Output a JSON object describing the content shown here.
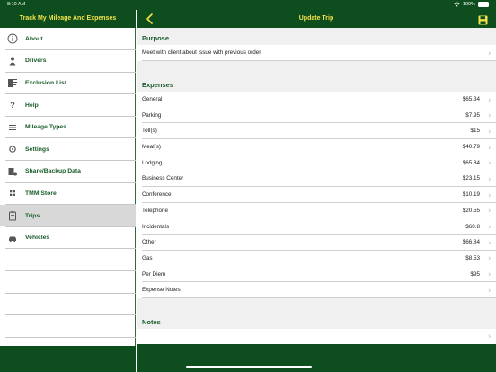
{
  "status": {
    "time": "8:10 AM",
    "battery": "100%"
  },
  "sidebar": {
    "title": "Track My Mileage And Expenses",
    "items": [
      {
        "label": "About",
        "icon": "info-icon"
      },
      {
        "label": "Drivers",
        "icon": "person-icon"
      },
      {
        "label": "Exclusion List",
        "icon": "exclusion-list-icon"
      },
      {
        "label": "Help",
        "icon": "question-icon"
      },
      {
        "label": "Mileage Types",
        "icon": "list-icon"
      },
      {
        "label": "Settings",
        "icon": "gear-icon"
      },
      {
        "label": "Share/Backup Data",
        "icon": "share-icon"
      },
      {
        "label": "TMM Store",
        "icon": "store-grid-icon"
      },
      {
        "label": "Trips",
        "icon": "clipboard-icon",
        "selected": true
      },
      {
        "label": "Vehicles",
        "icon": "car-icon"
      }
    ]
  },
  "header": {
    "title": "Update Trip"
  },
  "purpose": {
    "heading": "Purpose",
    "text": "Meet with client about issue with previous order"
  },
  "expenses": {
    "heading": "Expenses",
    "rows": [
      {
        "label": "General",
        "value": "$65.34"
      },
      {
        "label": "Parking",
        "value": "$7.95"
      },
      {
        "label": "Toll(s)",
        "value": "$15"
      },
      {
        "label": "Meal(s)",
        "value": "$40.79"
      },
      {
        "label": "Lodging",
        "value": "$65.84"
      },
      {
        "label": "Business Center",
        "value": "$23.15"
      },
      {
        "label": "Conference",
        "value": "$10.19"
      },
      {
        "label": "Telephone",
        "value": "$20.55"
      },
      {
        "label": "Incidentals",
        "value": "$60.8"
      },
      {
        "label": "Other",
        "value": "$66.84"
      },
      {
        "label": "Gas",
        "value": "$8.53"
      },
      {
        "label": "Per Diem",
        "value": "$95"
      },
      {
        "label": "Expense Notes",
        "value": ""
      }
    ]
  },
  "notes": {
    "heading": "Notes",
    "text": ""
  },
  "colors": {
    "brand_green": "#0e4d1d",
    "accent_yellow": "#f4e24a",
    "label_green": "#1a5c2a"
  }
}
